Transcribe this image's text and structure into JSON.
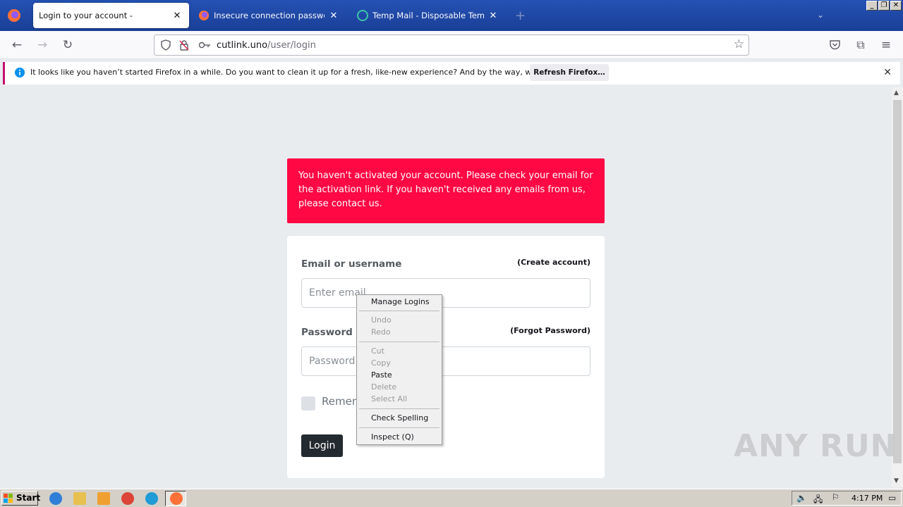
{
  "browser": {
    "tabs": [
      {
        "title": "Login to your account -",
        "active": true
      },
      {
        "title": "Insecure connection password war",
        "active": false
      },
      {
        "title": "Temp Mail - Disposable Temporary E",
        "active": false
      }
    ],
    "new_tab_glyph": "+",
    "url": {
      "host": "cutlink.uno",
      "path": "/user/login"
    },
    "notification": {
      "text": "It looks like you haven’t started Firefox in a while. Do you want to clean it up for a fresh, like-new experience? And by the way, welcome back!",
      "button": "Refresh Firefox…"
    }
  },
  "page": {
    "alert": "You haven't activated your account. Please check your email for the activation link. If you haven't received any emails from us, please contact us.",
    "alert_color": "#ff0844",
    "email_label": "Email or username",
    "create_account": "(Create account)",
    "email_placeholder": "Enter email",
    "password_label": "Password",
    "forgot_password": "(Forgot Password)",
    "password_placeholder": "Password",
    "remember_label": "Remem",
    "login_button": "Login"
  },
  "context_menu": {
    "items": [
      {
        "label": "Manage Logins",
        "enabled": true
      },
      {
        "label": "Undo",
        "enabled": false
      },
      {
        "label": "Redo",
        "enabled": false
      },
      {
        "label": "Cut",
        "enabled": false
      },
      {
        "label": "Copy",
        "enabled": false
      },
      {
        "label": "Paste",
        "enabled": true
      },
      {
        "label": "Delete",
        "enabled": false
      },
      {
        "label": "Select All",
        "enabled": false
      },
      {
        "label": "Check Spelling",
        "enabled": true
      },
      {
        "label": "Inspect (Q)",
        "enabled": true
      }
    ]
  },
  "watermark": "ANY RUN",
  "taskbar": {
    "start": "Start",
    "clock": "4:17 PM"
  }
}
